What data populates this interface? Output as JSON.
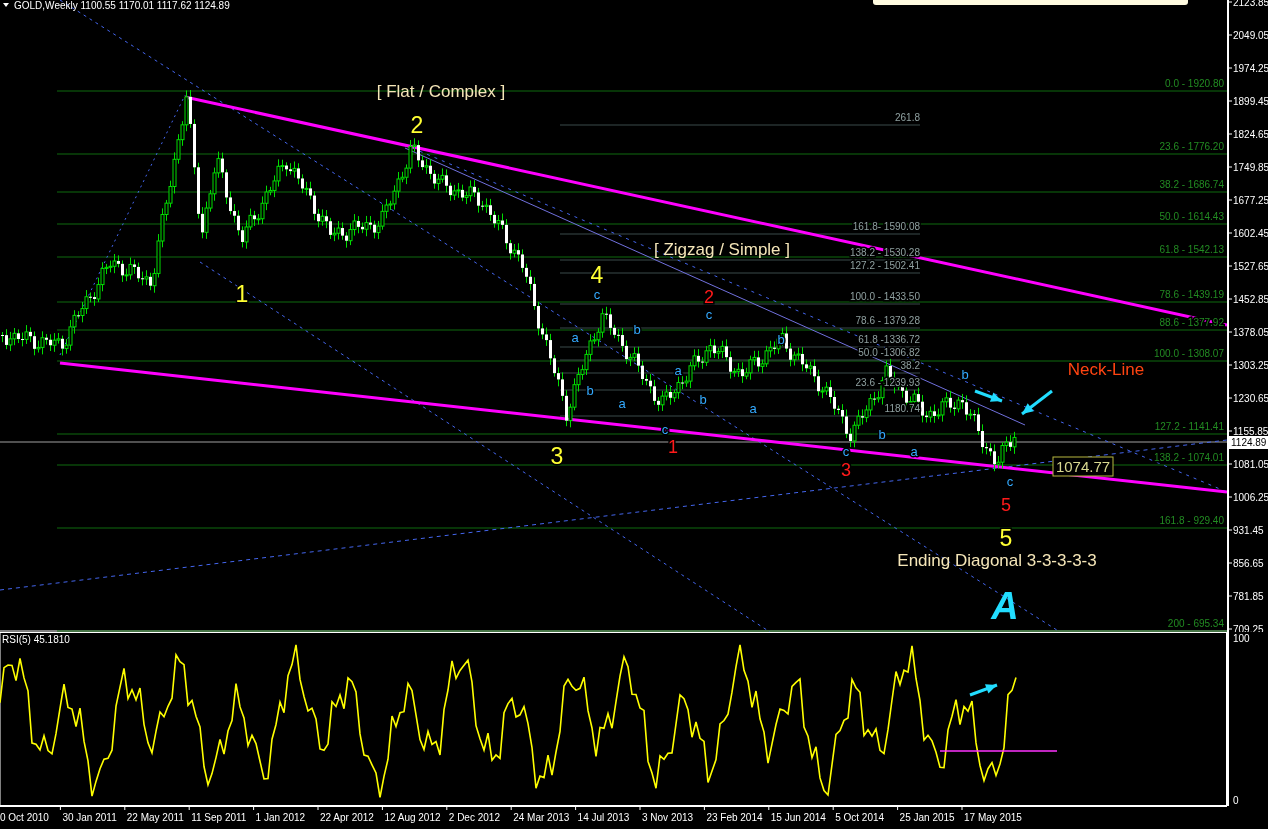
{
  "header": {
    "symbol": "GOLD,Weekly",
    "ohlc": "1100.55 1170.01 1117.62 1124.89"
  },
  "price_axis": {
    "labels": [
      "2123.85",
      "2049.05",
      "1974.25",
      "1899.45",
      "1824.65",
      "1749.85",
      "1677.25",
      "1602.45",
      "1527.65",
      "1452.85",
      "1378.05",
      "1303.25",
      "1230.65",
      "1155.85",
      "1081.05",
      "1006.25",
      "931.45",
      "856.65",
      "781.85",
      "709.25"
    ],
    "current_price": "1124.89"
  },
  "fib_main": [
    "0.0 - 1920.80",
    "23.6  - 1776.20",
    "38.2 - 1686.74",
    "50.0 - 1614.43",
    "61.8 - 1542.13",
    "78.6 - 1439.19",
    "88.6 - 1377.92",
    "100.0 - 1308.07",
    "127.2 - 1141.41",
    "138.2 - 1074.01",
    "161.8 - 929.40",
    "200 - 695.34"
  ],
  "fib_swing": [
    "261.8",
    "161.8- 1590.08",
    "138.2 - 1530.28",
    "127.2 - 1502.41",
    "100.0 - 1433.50",
    "78.6 - 1379.28",
    "61.8 -1336.72",
    "50.0 -1306.82",
    "38.2",
    "23.6 - 1239.93",
    "1180.74"
  ],
  "waves": [
    {
      "text": "1",
      "kind": "primary"
    },
    {
      "text": "2",
      "kind": "primary"
    },
    {
      "text": "3",
      "kind": "primary"
    },
    {
      "text": "4",
      "kind": "primary"
    },
    {
      "text": "5",
      "kind": "primary"
    },
    {
      "text": "1",
      "kind": "intermediate"
    },
    {
      "text": "2",
      "kind": "intermediate"
    },
    {
      "text": "3",
      "kind": "intermediate"
    },
    {
      "text": "5",
      "kind": "intermediate"
    },
    {
      "text": "c",
      "kind": "minor"
    },
    {
      "text": "a",
      "kind": "minor"
    },
    {
      "text": "b",
      "kind": "minor"
    },
    {
      "text": "a",
      "kind": "minor"
    },
    {
      "text": "b",
      "kind": "minor"
    },
    {
      "text": "c",
      "kind": "minor"
    },
    {
      "text": "a",
      "kind": "minor"
    },
    {
      "text": "b",
      "kind": "minor"
    },
    {
      "text": "c",
      "kind": "minor"
    },
    {
      "text": "a",
      "kind": "minor"
    },
    {
      "text": "b",
      "kind": "minor"
    },
    {
      "text": "c",
      "kind": "minor"
    },
    {
      "text": "b",
      "kind": "minor"
    },
    {
      "text": "a",
      "kind": "minor"
    },
    {
      "text": "b",
      "kind": "minor"
    },
    {
      "text": "c",
      "kind": "minor"
    }
  ],
  "annotations": [
    {
      "text": "[ Flat / Complex ]",
      "kind": "note"
    },
    {
      "text": "[ Zigzag / Simple ]",
      "kind": "note"
    },
    {
      "text": "Neck-Line",
      "kind": "alert"
    },
    {
      "text": "Ending Diagonal 3-3-3-3-3",
      "kind": "note"
    },
    {
      "text": "A",
      "kind": "logo"
    }
  ],
  "price_marker": "1074.77",
  "rsi": {
    "title": "RSI(5) 45.1810",
    "scale": [
      "100",
      "0"
    ]
  },
  "time_axis": [
    "0 Oct 2010",
    "30 Jan 2011",
    "22 May 2011",
    "11 Sep 2011",
    "1 Jan 2012",
    "22 Apr 2012",
    "12 Aug 2012",
    "2 Dec 2012",
    "24 Mar 2013",
    "14 Jul 2013",
    "3 Nov 2013",
    "23 Feb 2014",
    "15 Jun 2014",
    "5 Oct 2014",
    "25 Jan 2015",
    "17 May 2015"
  ]
}
